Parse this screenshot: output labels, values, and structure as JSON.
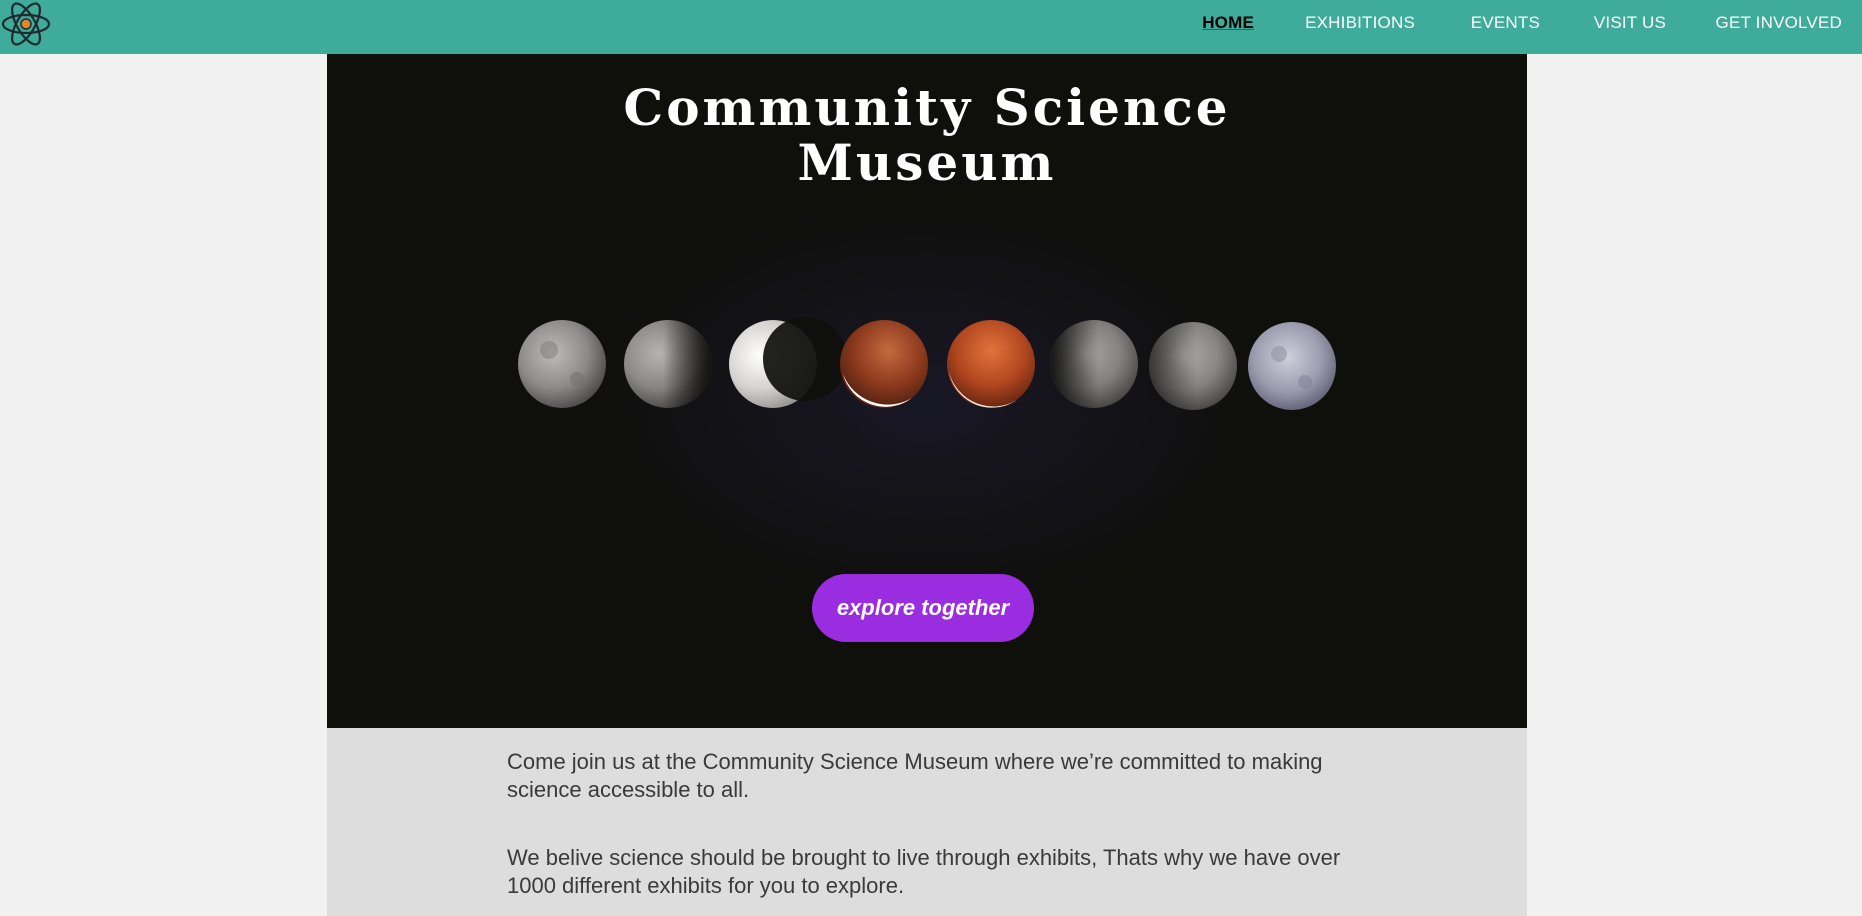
{
  "header": {
    "logo_icon": "atom-icon",
    "nav": [
      {
        "label": "HOME",
        "active": true
      },
      {
        "label": "EXHIBITIONS",
        "active": false
      },
      {
        "label": "EVENTS",
        "active": false
      },
      {
        "label": "VISIT US",
        "active": false
      },
      {
        "label": "GET INVOLVED",
        "active": false
      }
    ]
  },
  "hero": {
    "title_line1": "Community Science",
    "title_line2": "Museum",
    "image": "lunar-eclipse-phases-image",
    "cta_label": "explore together"
  },
  "intro": {
    "paragraph1": "Come join us at the Community Science Museum where we’re committed to making science accessible to all.",
    "paragraph2": "We belive science should be brought to live through exhibits, Thats why we have over 1000 different exhibits for you to explore."
  },
  "colors": {
    "header_bg": "#3eab9b",
    "hero_bg": "#0f0f0c",
    "cta_bg": "#9b2de0",
    "intro_bg": "#dddddd",
    "page_bg": "#f1f1f1"
  }
}
